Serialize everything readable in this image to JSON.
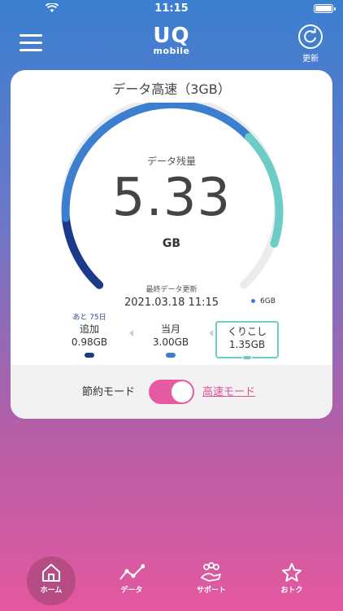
{
  "status_bar": {
    "time": "11:15"
  },
  "header": {
    "logo_main": "UQ",
    "logo_sub": "mobile",
    "refresh_label": "更新"
  },
  "plan": {
    "title": "データ高速（3GB）",
    "remaining_label": "データ残量",
    "remaining_value": "5.33",
    "remaining_unit": "GB",
    "updated_label": "最終データ更新",
    "updated_value": "2021.03.18 11:15",
    "capacity_label": "6GB",
    "remaining_fraction": 0.89,
    "breakdown": [
      {
        "badge": "あと 75日",
        "label": "追加",
        "value": "0.98GB",
        "color": "#1c3a8a"
      },
      {
        "badge": "",
        "label": "当月",
        "value": "3.00GB",
        "color": "#3c7fd0"
      },
      {
        "badge": "",
        "label": "くりこし",
        "value": "1.35GB",
        "color": "#6ccdc7"
      }
    ]
  },
  "mode": {
    "eco_label": "節約モード",
    "fast_label": "高速モード",
    "toggle_on": true
  },
  "tabs": [
    {
      "label": "ホーム",
      "icon": "home-icon",
      "active": true
    },
    {
      "label": "データ",
      "icon": "chart-icon",
      "active": false
    },
    {
      "label": "サポート",
      "icon": "support-icon",
      "active": false
    },
    {
      "label": "おトク",
      "icon": "star-icon",
      "active": false
    }
  ],
  "colors": {
    "accent": "#e55aa0",
    "blue": "#3c7fd0",
    "navy": "#1c3a8a",
    "teal": "#6ccdc7"
  }
}
